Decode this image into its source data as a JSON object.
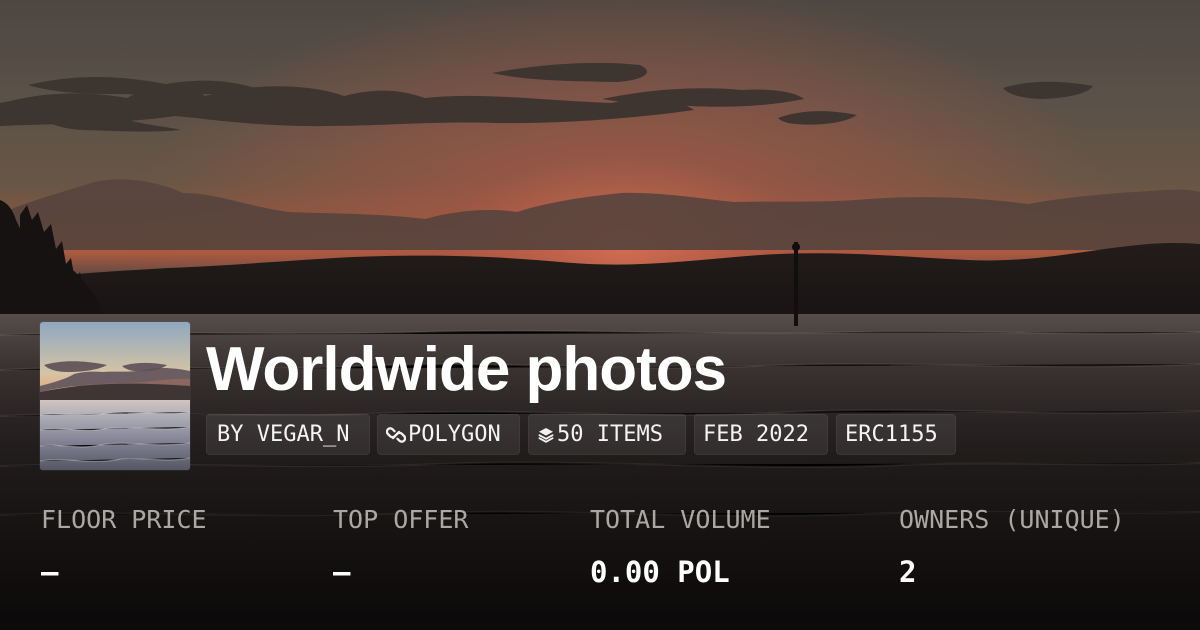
{
  "collection": {
    "title": "Worldwide photos",
    "chips": [
      {
        "label": "BY VEGAR_N",
        "icon": ""
      },
      {
        "label": "POLYGON",
        "icon": "chain-link-icon"
      },
      {
        "label": "50 ITEMS",
        "icon": "layers-icon"
      },
      {
        "label": "FEB 2022",
        "icon": ""
      },
      {
        "label": "ERC1155",
        "icon": ""
      }
    ],
    "stats": [
      {
        "label": "FLOOR PRICE",
        "value": "–"
      },
      {
        "label": "TOP OFFER",
        "value": "–"
      },
      {
        "label": "TOTAL VOLUME",
        "value": "0.00 POL"
      },
      {
        "label": "OWNERS (UNIQUE)",
        "value": "2"
      }
    ]
  },
  "colors": {
    "sunset_glow": "#c7654b",
    "sky_top": "#4b4741",
    "water_shadow": "#1b1716",
    "text_white": "#ffffff"
  }
}
